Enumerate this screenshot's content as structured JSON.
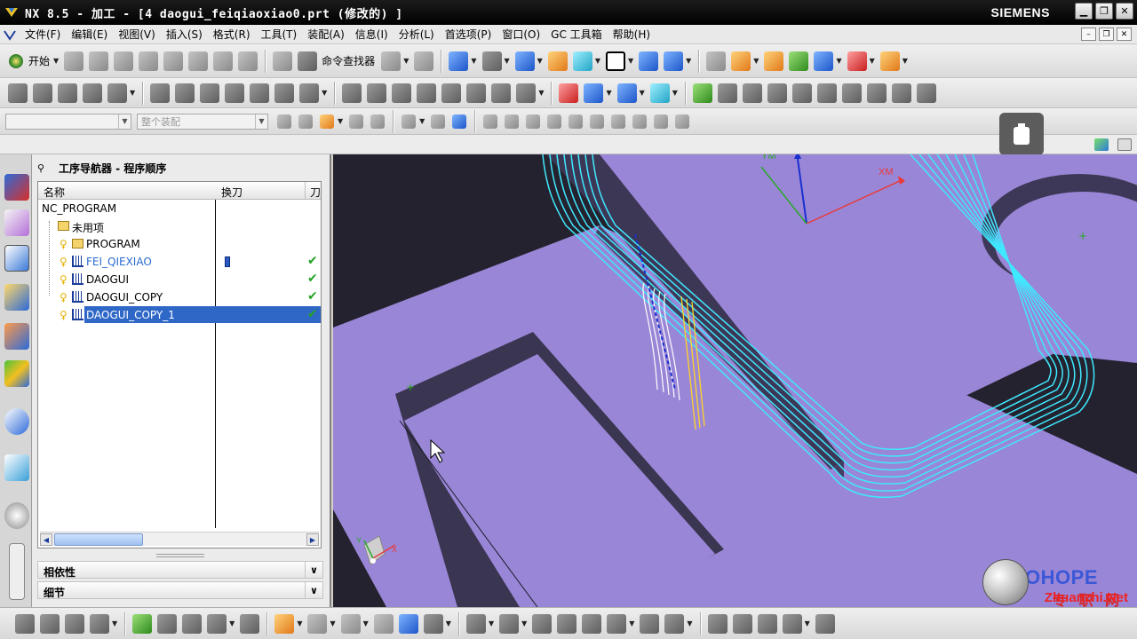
{
  "window": {
    "title": "NX 8.5 - 加工 - [4 daogui_feiqiaoxiao0.prt  (修改的) ]",
    "brand": "SIEMENS",
    "minimize": "▁",
    "restore": "❐",
    "close": "✕"
  },
  "menu": {
    "items": [
      "文件(F)",
      "编辑(E)",
      "视图(V)",
      "插入(S)",
      "格式(R)",
      "工具(T)",
      "装配(A)",
      "信息(I)",
      "分析(L)",
      "首选项(P)",
      "窗口(O)",
      "GC 工具箱",
      "帮助(H)"
    ],
    "doc_min": "–",
    "doc_restore": "❐",
    "doc_close": "✕"
  },
  "toolbar": {
    "start_label": "开始",
    "command_finder_label": "命令查找器",
    "assembly_filter_placeholder": "整个装配",
    "selection_filter_value": ""
  },
  "navigator": {
    "title": "工序导航器 - 程序顺序",
    "pin": "⚲",
    "columns": [
      "名称",
      "换刀",
      "刀"
    ],
    "rows": [
      {
        "name": "NC_PROGRAM",
        "level": 0,
        "type": "root",
        "status": "",
        "tool_change": false,
        "selected": false,
        "color": "#000000"
      },
      {
        "name": "未用项",
        "level": 1,
        "type": "folder",
        "status": "",
        "tool_change": false,
        "selected": false,
        "color": "#000000"
      },
      {
        "name": "PROGRAM",
        "level": 1,
        "type": "program",
        "status": "",
        "tool_change": false,
        "selected": false,
        "color": "#000000"
      },
      {
        "name": "FEI_QIEXIAO",
        "level": 1,
        "type": "operation",
        "status": "✔",
        "tool_change": true,
        "selected": false,
        "color": "#2a6bd1"
      },
      {
        "name": "DAOGUI",
        "level": 1,
        "type": "operation",
        "status": "✔",
        "tool_change": false,
        "selected": false,
        "color": "#000000"
      },
      {
        "name": "DAOGUI_COPY",
        "level": 1,
        "type": "operation",
        "status": "✔",
        "tool_change": false,
        "selected": false,
        "color": "#000000"
      },
      {
        "name": "DAOGUI_COPY_1",
        "level": 1,
        "type": "operation",
        "status": "✔",
        "tool_change": false,
        "selected": true,
        "color": "#ffffff"
      }
    ],
    "scroll_left": "◀",
    "scroll_right": "▶",
    "sections": [
      {
        "label": "相依性",
        "chevron": "∨"
      },
      {
        "label": "细节",
        "chevron": "∨"
      }
    ]
  },
  "viewport": {
    "axis_labels": {
      "xm": "XM",
      "ym": "YM",
      "x": "X",
      "y": "Y"
    },
    "watermark_brand": "GOHOPE",
    "watermark_cn": "专 职 网",
    "watermark_site": "Zhuanzhi.Net",
    "colors": {
      "part_face": "#9a86d6",
      "part_wall": "#403a58",
      "toolpath_cut": "#3fe9ff",
      "toolpath_engage": "#ffffff",
      "toolpath_yellow": "#ffd42a",
      "toolpath_blue": "#1a2fd0"
    }
  }
}
